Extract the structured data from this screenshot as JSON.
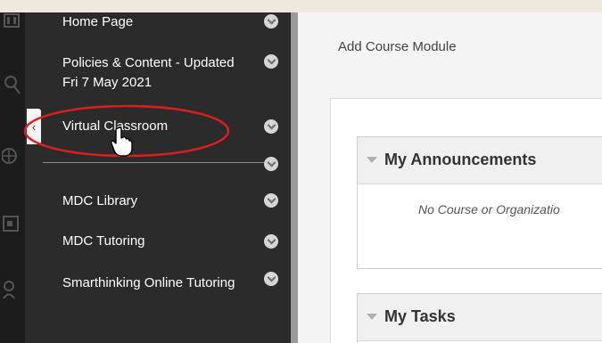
{
  "course_menu": {
    "items": [
      {
        "label": "Home Page"
      },
      {
        "label": "Policies & Content - Updated Fri 7 May 2021"
      },
      {
        "label": "Virtual Classroom"
      },
      {
        "label": "MDC Library"
      },
      {
        "label": "MDC Tutoring"
      },
      {
        "label": "Smarthinking Online Tutoring"
      }
    ],
    "collapse_glyph": "‹"
  },
  "main": {
    "add_module_label": "Add Course Module",
    "modules": [
      {
        "title": "My Announcements",
        "body": "No Course or Organizatio"
      },
      {
        "title": "My Tasks",
        "body": ""
      }
    ]
  },
  "icons": {
    "global_nav": [
      "institution-icon",
      "people-icon",
      "globe-icon",
      "calendar-icon",
      "user-icon"
    ],
    "annotation": "red-ellipse",
    "pointer": "hand-cursor"
  },
  "colors": {
    "menu_bg": "#2b2b2b",
    "global_nav_bg": "#1c1c1c",
    "highlight": "#d9201f"
  }
}
